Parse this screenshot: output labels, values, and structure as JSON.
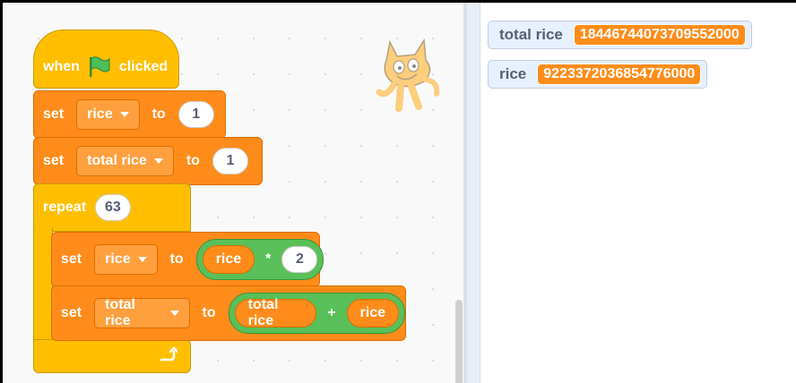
{
  "script": {
    "hat": {
      "when": "when",
      "flag_icon": "green-flag-icon",
      "clicked": "clicked"
    },
    "set1": {
      "set": "set",
      "var": "rice",
      "to": "to",
      "value": "1"
    },
    "set2": {
      "set": "set",
      "var": "total rice",
      "to": "to",
      "value": "1"
    },
    "repeat": {
      "label": "repeat",
      "count": "63",
      "loop_icon": "loop-arrow-icon"
    },
    "inner1": {
      "set": "set",
      "var": "rice",
      "to": "to",
      "lhs": "rice",
      "op": "*",
      "rhs": "2"
    },
    "inner2": {
      "set": "set",
      "var": "total rice",
      "to": "to",
      "lhs": "total rice",
      "op": "+",
      "rhs": "rice"
    }
  },
  "monitors": [
    {
      "name": "total rice",
      "value": "18446744073709552000"
    },
    {
      "name": "rice",
      "value": "9223372036854776000"
    }
  ],
  "colors": {
    "control": "#ffbf00",
    "variables": "#ff8c1a",
    "operators": "#59c059",
    "monitor_bg": "#e6f0ff"
  },
  "sprite": "scratch-cat"
}
